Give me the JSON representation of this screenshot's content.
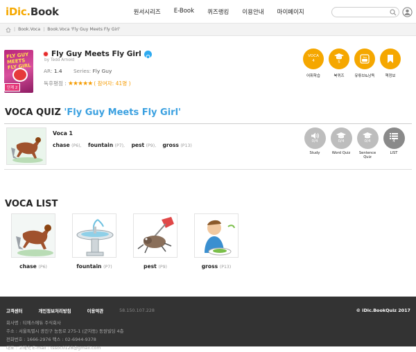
{
  "header": {
    "logo_part1": "iDic.",
    "logo_part2": "Book",
    "nav": [
      "원서시리즈",
      "E-Book",
      "퀴즈랭킹",
      "이용안내",
      "마이페이지"
    ],
    "search_placeholder": ""
  },
  "breadcrumb": {
    "items": [
      "Book.Voca",
      "Book.Voca 'Fly Guy Meets Fly Girl'"
    ]
  },
  "book": {
    "cover_title": "FLY GUY MEETS FLY GIRL",
    "cover_tag": "단계 2",
    "title": "Fly Guy Meets Fly Girl",
    "author": "by Tedd Arnold",
    "ar_label": "AR:",
    "ar_value": "1.4",
    "series_label": "Series:",
    "series_value": "Fly Guy",
    "rating_label": "독후평점 :",
    "stars": "★★★★★",
    "participants": "( 참여자: 41명 )"
  },
  "actions": [
    {
      "top": "VOCA",
      "num": "4",
      "label": "어휘학습",
      "icon": "voca-icon"
    },
    {
      "top": "",
      "num": "5",
      "label": "북퀴즈",
      "icon": "graduation-cap-icon"
    },
    {
      "top": "",
      "num": "",
      "label": "유튜브&낭독",
      "icon": "youtube-icon"
    },
    {
      "top": "",
      "num": "",
      "label": "책정보",
      "icon": "bookmark-icon"
    }
  ],
  "quiz": {
    "heading_prefix": "VOCA QUIZ ",
    "heading_title": "'Fly Guy Meets Fly Girl'",
    "set_title": "Voca 1",
    "words": [
      {
        "word": "chase",
        "page": "(P6),"
      },
      {
        "word": "fountain",
        "page": "(P7),"
      },
      {
        "word": "pest",
        "page": "(P9),"
      },
      {
        "word": "gross",
        "page": "(P13)"
      }
    ],
    "modes": [
      {
        "value": "0/4",
        "label": "Study",
        "icon": "speaker-icon"
      },
      {
        "value": "0/4",
        "label": "Word Quiz",
        "icon": "graduation-cap-icon"
      },
      {
        "value": "0/4",
        "label": "Sentence Quiz",
        "icon": "graduation-cap-icon"
      },
      {
        "value": "4",
        "label": "LIST",
        "icon": "list-icon"
      }
    ]
  },
  "voca_list": {
    "heading": "VOCA LIST",
    "items": [
      {
        "word": "chase",
        "page": "(P6)"
      },
      {
        "word": "fountain",
        "page": "(P7)"
      },
      {
        "word": "pest",
        "page": "(P9)"
      },
      {
        "word": "gross",
        "page": "(P13)"
      }
    ]
  },
  "footer": {
    "links": [
      "고객센터",
      "개인정보처리방침",
      "이용약관"
    ],
    "ip": "58.150.107.228",
    "copyright": "© iDic.BookQuiz 2017",
    "info": [
      "회사명 : 티에스에듀 주식회사",
      "주소 : 서울특별시 광진구 능동로 275-1 (군자동) 동원빌딩 4층",
      "전화번호 : 1666-2976      팩스 : 02-6944-9378",
      "대표 : 고혜숙      E-mail : tssoc0128@gmail.com"
    ]
  },
  "colors": {
    "accent": "#f5a700",
    "brand_yellow": "#f5a800",
    "link_blue": "#3aa0e0",
    "grey_button": "#bdbdbd"
  }
}
